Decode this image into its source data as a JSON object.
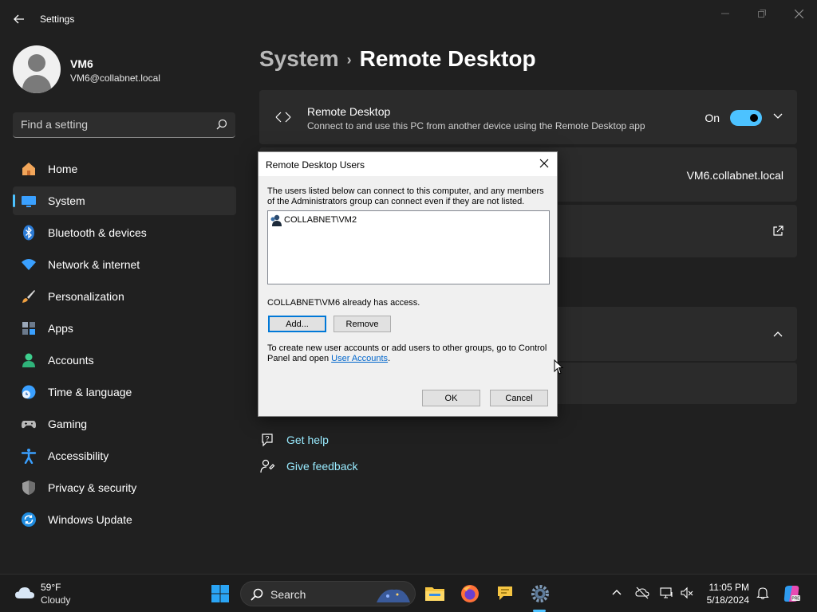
{
  "app": {
    "title": "Settings"
  },
  "user": {
    "name": "VM6",
    "email": "VM6@collabnet.local"
  },
  "search": {
    "placeholder": "Find a setting"
  },
  "nav": {
    "items": [
      {
        "label": "Home",
        "icon": "home-icon"
      },
      {
        "label": "System",
        "icon": "system-icon",
        "active": true
      },
      {
        "label": "Bluetooth & devices",
        "icon": "bluetooth-icon"
      },
      {
        "label": "Network & internet",
        "icon": "network-icon"
      },
      {
        "label": "Personalization",
        "icon": "brush-icon"
      },
      {
        "label": "Apps",
        "icon": "apps-icon"
      },
      {
        "label": "Accounts",
        "icon": "accounts-icon"
      },
      {
        "label": "Time & language",
        "icon": "clock-globe-icon"
      },
      {
        "label": "Gaming",
        "icon": "gamepad-icon"
      },
      {
        "label": "Accessibility",
        "icon": "accessibility-icon"
      },
      {
        "label": "Privacy & security",
        "icon": "shield-icon"
      },
      {
        "label": "Windows Update",
        "icon": "update-icon"
      }
    ]
  },
  "breadcrumb": {
    "parent": "System",
    "separator": "›",
    "current": "Remote Desktop"
  },
  "remote_desktop": {
    "title": "Remote Desktop",
    "subtitle": "Connect to and use this PC from another device using the Remote Desktop app",
    "toggle_label": "On",
    "toggle_on": true
  },
  "pc_name": "VM6.collabnet.local",
  "help": {
    "get_help": "Get help",
    "give_feedback": "Give feedback"
  },
  "dialog": {
    "title": "Remote Desktop Users",
    "description": "The users listed below can connect to this computer, and any members of the Administrators group can connect even if they are not listed.",
    "users": [
      "COLLABNET\\VM2"
    ],
    "access_note": "COLLABNET\\VM6 already has access.",
    "add_label": "Add...",
    "remove_label": "Remove",
    "bottom_text": "To create new user accounts or add users to other groups, go to Control Panel and open ",
    "link_text": "User Accounts",
    "bottom_suffix": ".",
    "ok_label": "OK",
    "cancel_label": "Cancel"
  },
  "taskbar": {
    "weather_temp": "59°F",
    "weather_desc": "Cloudy",
    "search_label": "Search",
    "time": "11:05 PM",
    "date": "5/18/2024"
  },
  "colors": {
    "accent": "#4cc2ff",
    "background": "#202020",
    "card": "#2b2b2b",
    "dialog": "#f0f0f0"
  }
}
